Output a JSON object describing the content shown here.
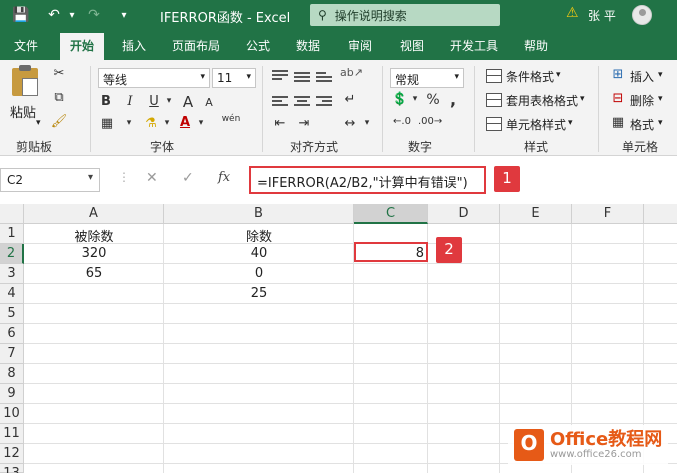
{
  "titlebar": {
    "title": "IFERROR函数 - Excel",
    "search_placeholder": "操作说明搜索",
    "user": "张 平"
  },
  "tabs": [
    "文件",
    "开始",
    "插入",
    "页面布局",
    "公式",
    "数据",
    "审阅",
    "视图",
    "开发工具",
    "帮助"
  ],
  "active_tab": "开始",
  "ribbon": {
    "clipboard": {
      "paste": "粘贴",
      "label": "剪贴板"
    },
    "font": {
      "name": "等线",
      "size": "11",
      "bold": "B",
      "italic": "I",
      "underline": "U",
      "grow": "A",
      "shrink": "A",
      "phonetic": "wén",
      "label": "字体"
    },
    "alignment": {
      "label": "对齐方式"
    },
    "number": {
      "format": "常规",
      "percent": "%",
      "comma": ",",
      "label": "数字"
    },
    "styles": {
      "conditional": "条件格式",
      "table": "套用表格格式",
      "cell": "单元格样式",
      "label": "样式"
    },
    "cells": {
      "insert": "插入",
      "delete": "删除",
      "format": "格式",
      "label": "单元格"
    }
  },
  "formula_bar": {
    "name_box": "C2",
    "fx": "fx",
    "cancel": "✕",
    "enter": "✓",
    "formula": "=IFERROR(A2/B2,\"计算中有错误\")"
  },
  "badges": {
    "one": "1",
    "two": "2"
  },
  "columns": [
    "A",
    "B",
    "C",
    "D",
    "E",
    "F"
  ],
  "rows": [
    "1",
    "2",
    "3",
    "4",
    "5",
    "6",
    "7",
    "8",
    "9",
    "10",
    "11",
    "12",
    "13"
  ],
  "cells": {
    "A1": "被除数",
    "B1": "除数",
    "A2": "320",
    "B2": "40",
    "C2": "8",
    "A3": "65",
    "B3": "0",
    "B4": "25"
  },
  "watermark": {
    "brand": "Office教程网",
    "url": "www.office26.com",
    "logo": "O"
  },
  "colors": {
    "accent": "#217346",
    "highlight": "#e0393e",
    "watermark": "#e65a17"
  }
}
